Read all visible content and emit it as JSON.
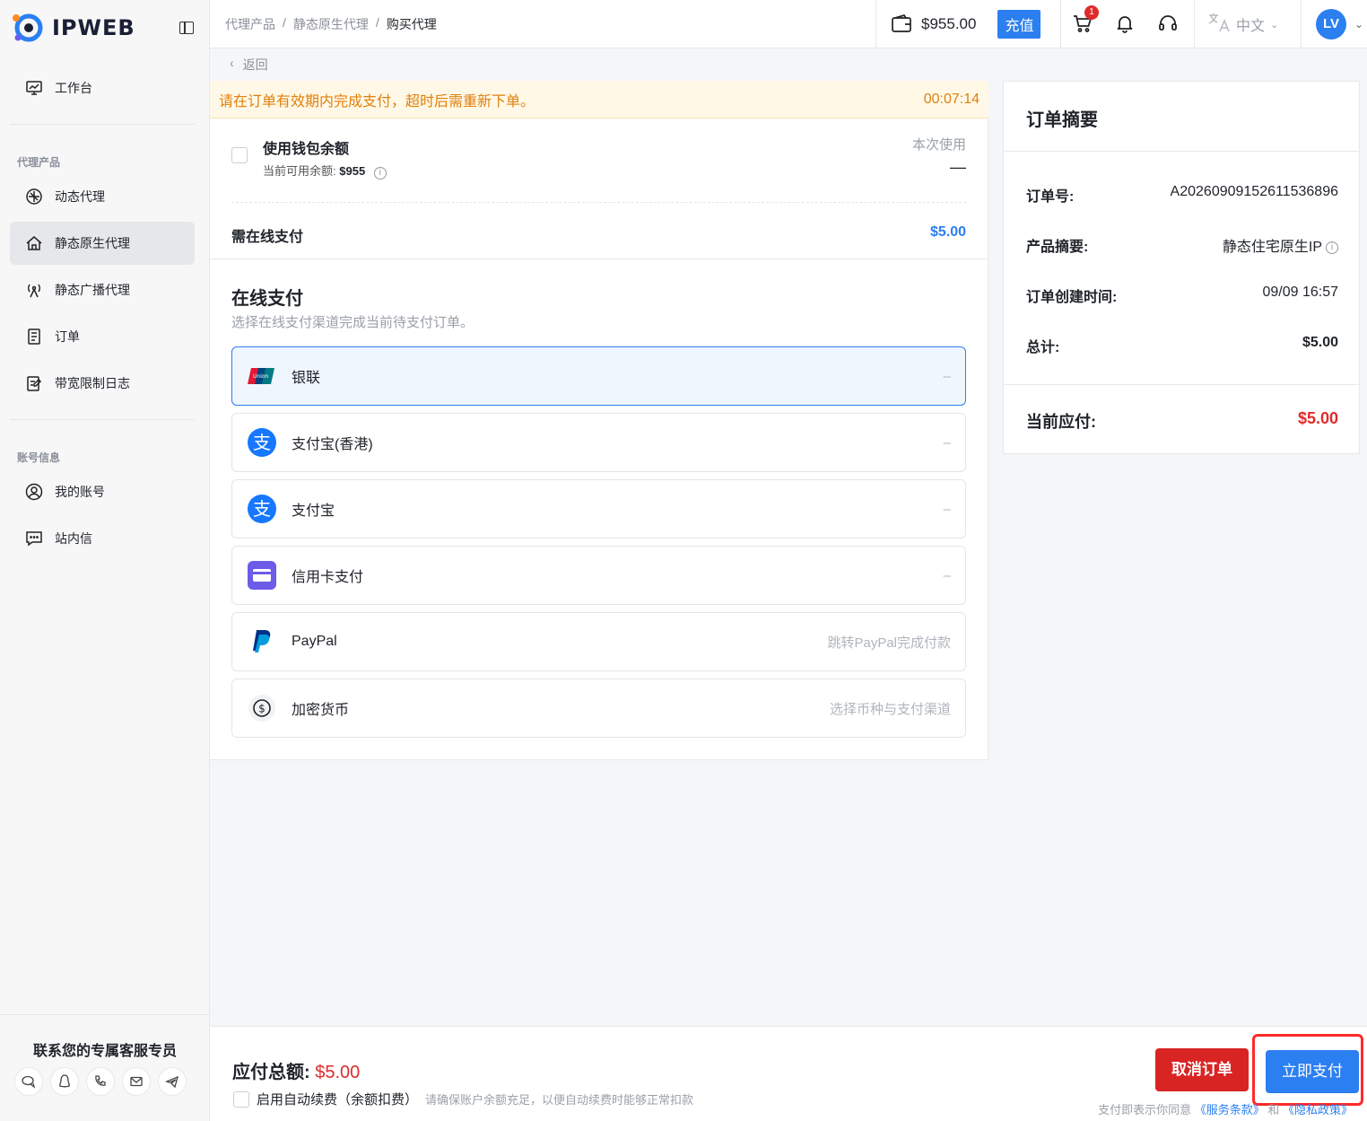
{
  "brand": {
    "name": "IPWEB"
  },
  "sidebar": {
    "top_item": {
      "label": "工作台"
    },
    "section_proxy": "代理产品",
    "items": [
      {
        "label": "动态代理"
      },
      {
        "label": "静态原生代理"
      },
      {
        "label": "静态广播代理"
      },
      {
        "label": "订单"
      },
      {
        "label": "带宽限制日志"
      }
    ],
    "section_account": "账号信息",
    "account_items": [
      {
        "label": "我的账号"
      },
      {
        "label": "站内信"
      }
    ],
    "contact_title": "联系您的专属客服专员"
  },
  "header": {
    "breadcrumb": [
      "代理产品",
      "静态原生代理",
      "购买代理"
    ],
    "breadcrumb_sep": "/",
    "balance": "$955.00",
    "recharge": "充值",
    "cart_badge": "1",
    "language": "中文",
    "avatar": "LV"
  },
  "back": "返回",
  "notice": {
    "text": "请在订单有效期内完成支付，超时后需重新下单。",
    "timer": "00:07:14"
  },
  "wallet": {
    "title": "使用钱包余额",
    "available_label": "当前可用余额:",
    "available_value": "$955",
    "this_use_label": "本次使用",
    "this_use_value": "—"
  },
  "online_need": {
    "label": "需在线支付",
    "amount": "$5.00"
  },
  "online_pay": {
    "title": "在线支付",
    "subtitle": "选择在线支付渠道完成当前待支付订单。",
    "methods": [
      {
        "label": "银联",
        "right": "–"
      },
      {
        "label": "支付宝(香港)",
        "right": "–"
      },
      {
        "label": "支付宝",
        "right": "–"
      },
      {
        "label": "信用卡支付",
        "right": "–"
      },
      {
        "label": "PayPal",
        "right": "跳转PayPal完成付款"
      },
      {
        "label": "加密货币",
        "right": "选择币种与支付渠道"
      }
    ]
  },
  "summary": {
    "title": "订单摘要",
    "order_no_label": "订单号:",
    "order_no": "A20260909152611536896",
    "product_label": "产品摘要:",
    "product": "静态住宅原生IP",
    "created_label": "订单创建时间:",
    "created": "09/09 16:57",
    "total_label": "总计:",
    "total": "$5.00",
    "due_label": "当前应付:",
    "due": "$5.00"
  },
  "footer": {
    "total_label": "应付总额:",
    "total_value": "$5.00",
    "auto_renew_label": "启用自动续费（余额扣费）",
    "auto_renew_hint": "请确保账户余额充足，以便自动续费时能够正常扣款",
    "cancel": "取消订单",
    "pay": "立即支付",
    "terms_prefix": "支付即表示你同意",
    "terms_service": "《服务条款》",
    "terms_and": "和",
    "terms_privacy": "《隐私政策》"
  },
  "colors": {
    "accent": "#2b7ff0",
    "danger": "#e02b2b",
    "warning": "#e0800c"
  }
}
